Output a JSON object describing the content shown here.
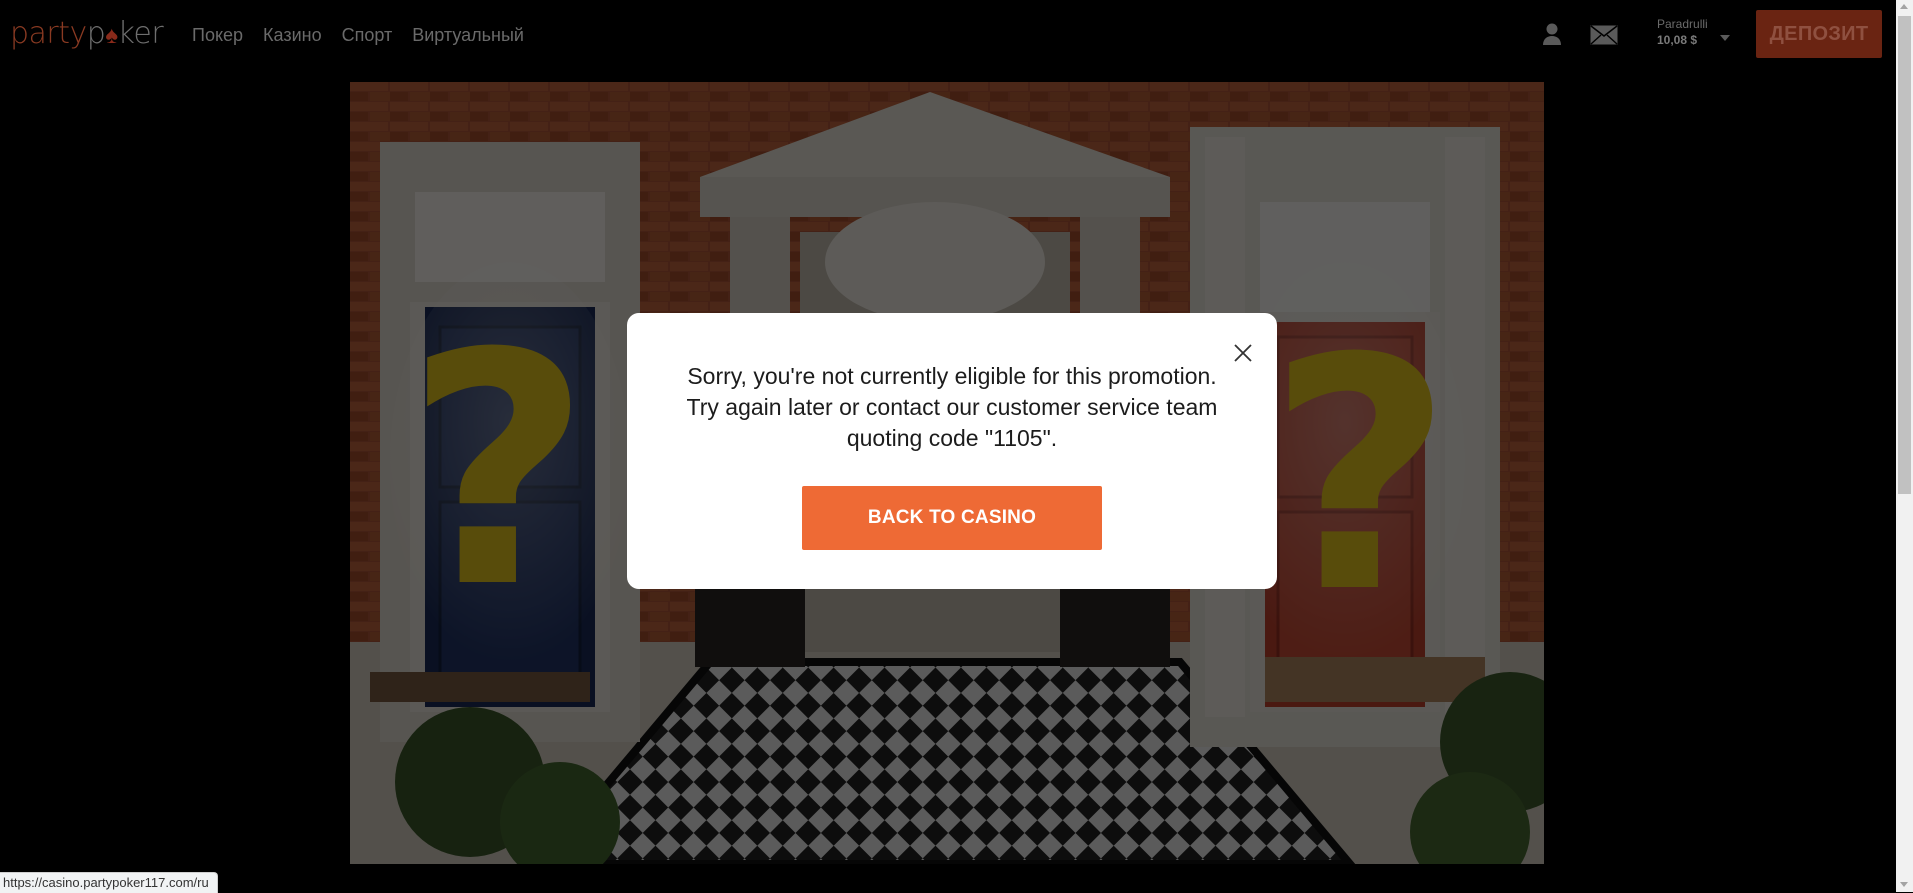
{
  "header": {
    "logo": {
      "part1": "party",
      "part2a": "p",
      "spade": "♠",
      "part2b": "ker"
    },
    "nav": [
      "Покер",
      "Казино",
      "Спорт",
      "Виртуальный"
    ],
    "account": {
      "username": "Paradrulli",
      "balance": "10,08 $"
    },
    "deposit_label": "ДЕПОЗИТ"
  },
  "modal": {
    "message_line1": "Sorry, you're not currently eligible for this promotion.",
    "message_line2": "Try again later or contact our customer service team",
    "message_line3": "quoting code \"1105\".",
    "button_label": "BACK TO CASINO"
  },
  "status_bar": {
    "url": "https://casino.partypoker117.com/ru"
  },
  "colors": {
    "accent": "#ee6a35",
    "deposit_bg": "#6a2412",
    "background": "#000000"
  },
  "icons": [
    "user-icon",
    "envelope-icon",
    "chevron-down-icon",
    "close-icon",
    "question-mark-icon"
  ]
}
